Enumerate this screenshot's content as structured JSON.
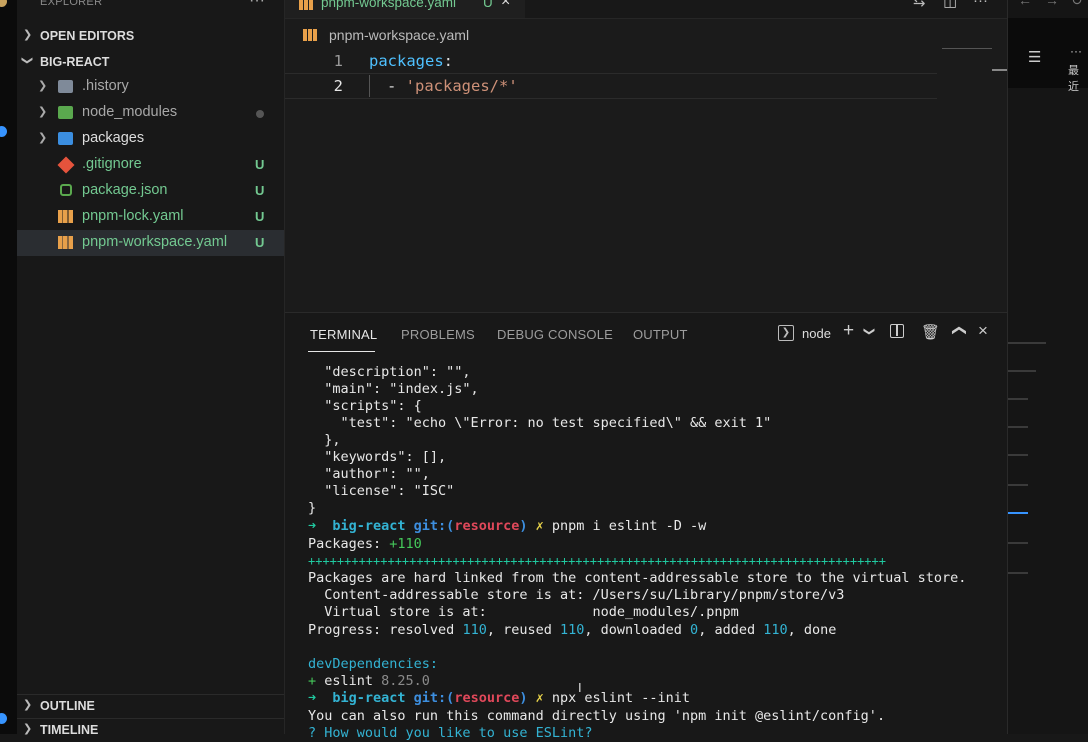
{
  "colors": {
    "accent": "#3794ff",
    "untracked": "#73c991",
    "yaml_icon": "#e8a04a",
    "terminal_green": "#20c9a0",
    "terminal_red": "#e0485a"
  },
  "sidebar": {
    "title": "EXPLORER",
    "more": "···",
    "open_editors": "OPEN EDITORS",
    "project": "BIG-REACT",
    "items": [
      {
        "label": ".history",
        "icon": "folder-icon",
        "badge": ""
      },
      {
        "label": "node_modules",
        "icon": "node-folder-icon",
        "badge": "●"
      },
      {
        "label": "packages",
        "icon": "folder-icon",
        "badge": ""
      },
      {
        "label": ".gitignore",
        "icon": "git-icon",
        "badge": "U"
      },
      {
        "label": "package.json",
        "icon": "nodejs-icon",
        "badge": "U"
      },
      {
        "label": "pnpm-lock.yaml",
        "icon": "pnpm-icon",
        "badge": "U"
      },
      {
        "label": "pnpm-workspace.yaml",
        "icon": "pnpm-icon",
        "badge": "U"
      }
    ],
    "outline": "OUTLINE",
    "timeline": "TIMELINE"
  },
  "editor": {
    "tab": {
      "label": "pnpm-workspace.yaml",
      "badge": "U",
      "close": "×"
    },
    "breadcrumb": "pnpm-workspace.yaml",
    "lines": [
      {
        "num": "1",
        "key": "packages",
        "colon": ":"
      },
      {
        "num": "2",
        "dash": "- ",
        "value": "'packages/*'"
      }
    ]
  },
  "rightbar": {
    "more": "···",
    "recent": "最近"
  },
  "panel": {
    "tabs": [
      "TERMINAL",
      "PROBLEMS",
      "DEBUG CONSOLE",
      "OUTPUT"
    ],
    "shell": "node",
    "lines": [
      "  \"description\": \"\",",
      "  \"main\": \"index.js\",",
      "  \"scripts\": {",
      "    \"test\": \"echo \\\"Error: no test specified\\\" && exit 1\"",
      "  },",
      "  \"keywords\": [],",
      "  \"author\": \"\",",
      "  \"license\": \"ISC\"",
      "}"
    ],
    "prompt1": {
      "arrow": "➜  ",
      "dir": "big-react ",
      "git": "git:(",
      "branch": "resource",
      "close": ")",
      "x": " ✗ ",
      "cmd": "pnpm i eslint -D -w"
    },
    "packages": {
      "label": "Packages: ",
      "value": "+110"
    },
    "plusbar": "++++++++++++++++++++++++++++++++++++++++++++++++++++++++++++++++++++++++++++++++",
    "hardlink": "Packages are hard linked from the content-addressable store to the virtual store.",
    "store1": "  Content-addressable store is at: /Users/su/Library/pnpm/store/v3",
    "store2": "  Virtual store is at:             node_modules/.pnpm",
    "progress": {
      "a": "Progress: resolved ",
      "b": "110",
      "c": ", reused ",
      "d": "110",
      "e": ", downloaded ",
      "f": "0",
      "g": ", added ",
      "h": "110",
      "i": ", done"
    },
    "devdeps": "devDependencies:",
    "eslint": {
      "plus": "+ ",
      "name": "eslint ",
      "ver": "8.25.0"
    },
    "prompt2": {
      "arrow": "➜  ",
      "dir": "big-react ",
      "git": "git:(",
      "branch": "resource",
      "close": ")",
      "x": " ✗ ",
      "cmd": "npx eslint --init"
    },
    "info": "You can also run this command directly using 'npm init @eslint/config'.",
    "question": "? How would you like to use ESLint?"
  }
}
